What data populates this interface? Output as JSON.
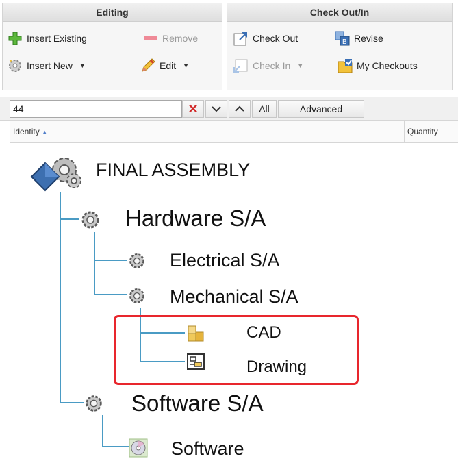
{
  "ribbon": {
    "editing": {
      "title": "Editing",
      "insert_existing": "Insert Existing",
      "remove": "Remove",
      "insert_new": "Insert New",
      "edit": "Edit"
    },
    "checkout": {
      "title": "Check Out/In",
      "check_out": "Check Out",
      "revise": "Revise",
      "check_in": "Check In",
      "my_checkouts": "My Checkouts"
    }
  },
  "search": {
    "value": "44",
    "all_label": "All",
    "advanced_label": "Advanced"
  },
  "columns": {
    "identity": "Identity",
    "quantity": "Quantity"
  },
  "tree": {
    "root": "FINAL ASSEMBLY",
    "hardware": "Hardware S/A",
    "electrical": "Electrical S/A",
    "mechanical": "Mechanical S/A",
    "cad": "CAD",
    "drawing": "Drawing",
    "software_sa": "Software S/A",
    "software": "Software"
  },
  "colors": {
    "highlight": "#e8262d",
    "tree_line": "#4a9bc4",
    "accent_blue": "#3a6fb5"
  }
}
